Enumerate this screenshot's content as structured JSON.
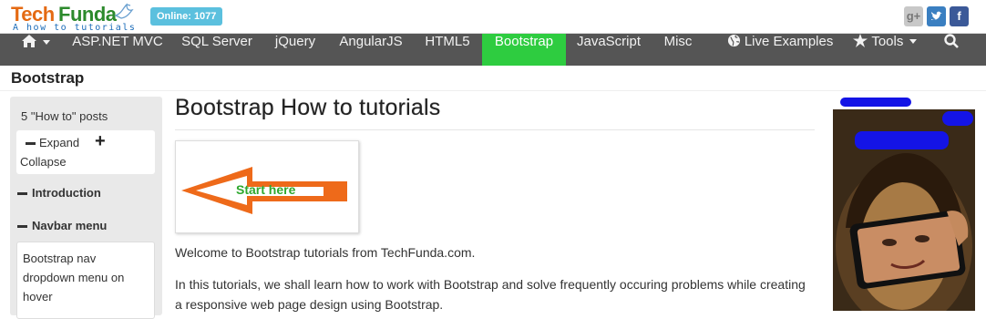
{
  "header": {
    "logo_tech": "Tech",
    "logo_funda": "Funda",
    "tagline": "A how to tutorials",
    "online_badge": "Online: 1077",
    "social": {
      "google": "g+",
      "twitter": "t",
      "facebook": "f"
    }
  },
  "nav": {
    "items": [
      {
        "label": "ASP.NET MVC"
      },
      {
        "label": "SQL Server"
      },
      {
        "label": "jQuery"
      },
      {
        "label": "AngularJS"
      },
      {
        "label": "HTML5"
      },
      {
        "label": "Bootstrap"
      },
      {
        "label": "JavaScript"
      },
      {
        "label": "Misc"
      },
      {
        "label": "Live Examples"
      },
      {
        "label": "Tools"
      }
    ],
    "active": "Bootstrap",
    "active_color": "#2ecc40"
  },
  "page": {
    "section_title": "Bootstrap"
  },
  "sidebar": {
    "posts_count": "5 \"How to\" posts",
    "expand": "Expand",
    "collapse": "Collapse",
    "sections": [
      {
        "label": "Introduction"
      },
      {
        "label": "Navbar menu"
      }
    ],
    "sublink": "Bootstrap nav dropdown menu on hover"
  },
  "main": {
    "title": "Bootstrap How to tutorials",
    "start_label": "Start here",
    "para1": "Welcome to Bootstrap tutorials from TechFunda.com.",
    "para2": "In this tutorials, we shall learn how to work with Bootstrap and solve frequently occuring problems while creating a responsive web page design using Bootstrap."
  },
  "icons": [
    "home-icon",
    "caret-down-icon",
    "globe-icon",
    "star-icon",
    "search-icon",
    "bird-icon",
    "minus-icon",
    "plus-icon",
    "arrow-icon"
  ]
}
